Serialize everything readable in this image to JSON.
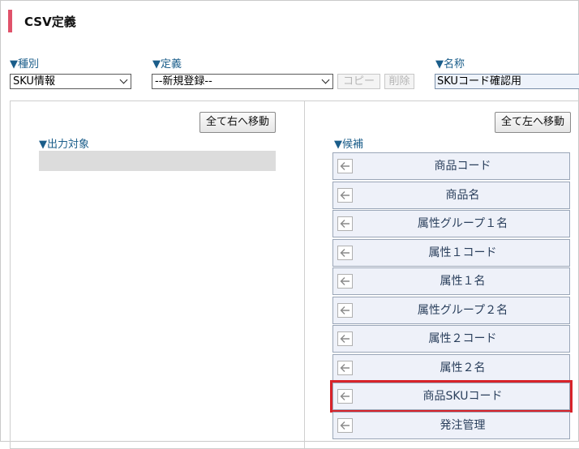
{
  "page_title": "CSV定義",
  "filters": {
    "type_label": "▼種別",
    "type_value": "SKU情報",
    "definition_label": "▼定義",
    "definition_value": "--新規登録--",
    "copy_label": "コピー",
    "delete_label": "削除",
    "name_label": "▼名称",
    "name_value": "SKUコード確認用"
  },
  "left_panel": {
    "move_all_right_label": "全て右へ移動",
    "output_target_label": "▼出力対象"
  },
  "right_panel": {
    "move_all_left_label": "全て左へ移動",
    "candidates_label": "▼候補",
    "candidates": [
      {
        "label": "商品コード"
      },
      {
        "label": "商品名"
      },
      {
        "label": "属性グループ１名"
      },
      {
        "label": "属性１コード"
      },
      {
        "label": "属性１名"
      },
      {
        "label": "属性グループ２名"
      },
      {
        "label": "属性２コード"
      },
      {
        "label": "属性２名"
      },
      {
        "label": "商品SKUコード",
        "highlighted": true
      },
      {
        "label": "発注管理"
      }
    ]
  },
  "colors": {
    "title_accent": "#e0526a",
    "label_blue": "#1a5d8a",
    "highlight_red": "#d8232a"
  },
  "icons": {
    "candidate_move": "arrow-left-icon",
    "dropdown": "chevron-down-icon"
  }
}
